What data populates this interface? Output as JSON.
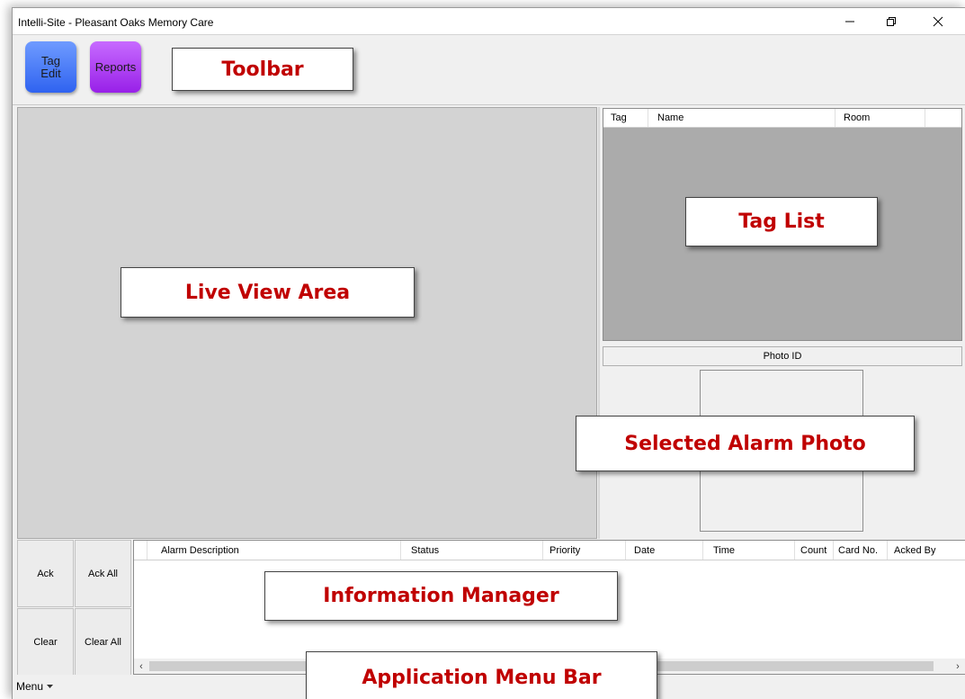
{
  "window": {
    "title": "Intelli-Site - Pleasant Oaks Memory Care",
    "controls": [
      "minimize-icon",
      "restore-icon",
      "close-icon"
    ]
  },
  "toolbar": {
    "buttons": [
      {
        "label_line1": "Tag",
        "label_line2": "Edit",
        "color": "#3d6ff5"
      },
      {
        "label": "Reports",
        "color": "#a42ef0"
      }
    ]
  },
  "tag_list": {
    "columns": [
      "Tag",
      "Name",
      "Room"
    ],
    "rows": []
  },
  "photo": {
    "label": "Photo ID"
  },
  "alarm_actions": {
    "ack": "Ack",
    "ack_all": "Ack All",
    "clear": "Clear",
    "clear_all": "Clear All"
  },
  "info_manager": {
    "columns": [
      "Alarm Description",
      "Status",
      "Priority",
      "Date",
      "Time",
      "Count",
      "Card No.",
      "Acked By"
    ],
    "rows": []
  },
  "menubar": {
    "menu_label": "Menu"
  },
  "callouts": {
    "toolbar": "Toolbar",
    "tag_list": "Tag List",
    "live_view": "Live View Area",
    "alarm_photo": "Selected Alarm Photo",
    "info_manager": "Information Manager",
    "menu_bar": "Application Menu Bar"
  },
  "colors": {
    "callout_text": "#c00000",
    "live_view_bg": "#d3d3d3",
    "tag_list_bg": "#ababab"
  }
}
